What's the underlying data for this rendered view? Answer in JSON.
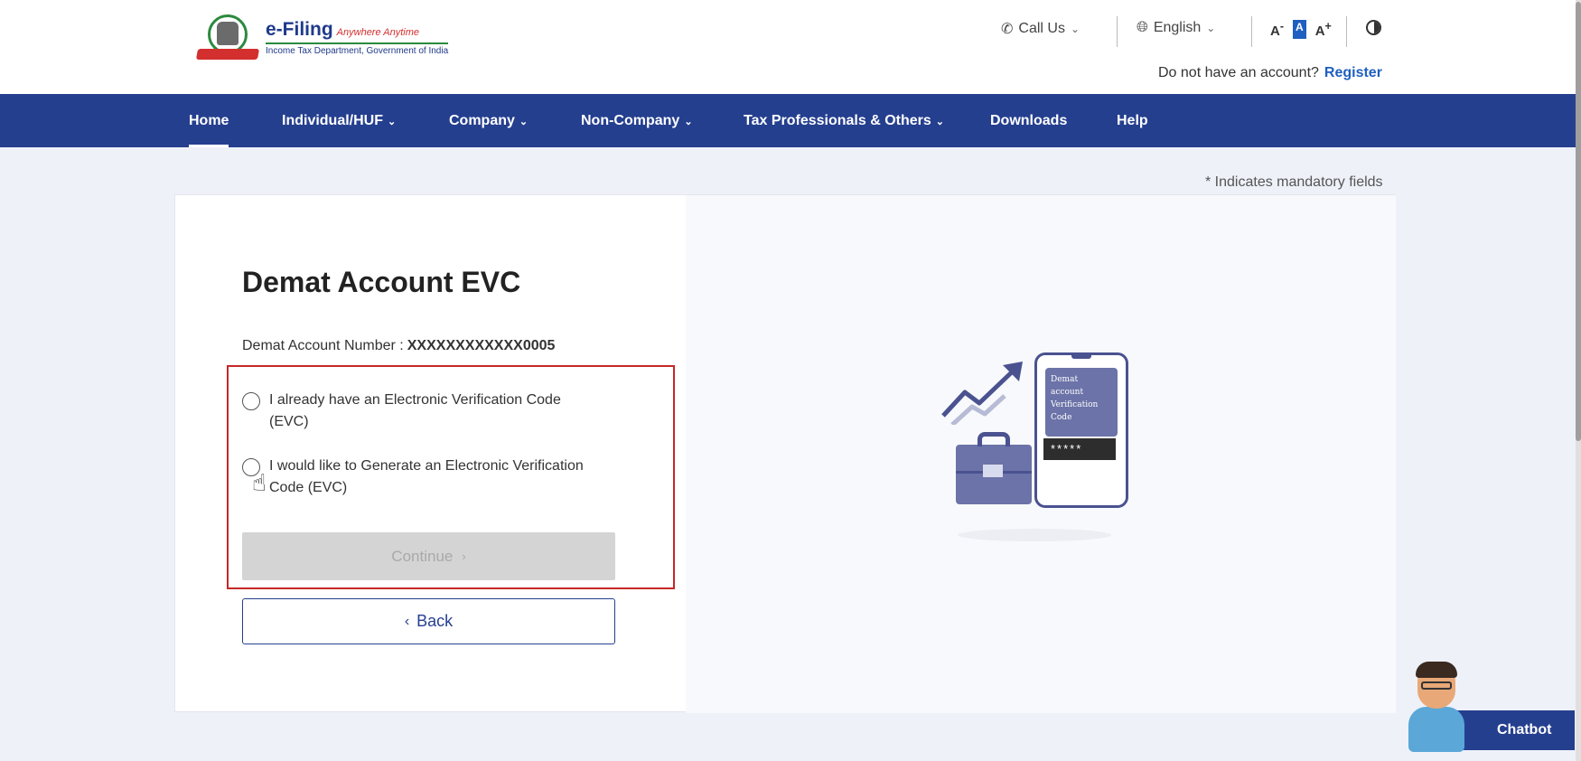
{
  "header": {
    "logo_title": "e-Filing",
    "logo_tagline": "Anywhere Anytime",
    "logo_subtitle": "Income Tax Department, Government of India",
    "call_us": "Call Us",
    "language": "English",
    "font_decrease": "A",
    "font_default": "A",
    "font_increase": "A",
    "account_prompt": "Do not have an account?",
    "register": "Register"
  },
  "nav": {
    "items": [
      {
        "label": "Home"
      },
      {
        "label": "Individual/HUF"
      },
      {
        "label": "Company"
      },
      {
        "label": "Non-Company"
      },
      {
        "label": "Tax Professionals & Others"
      },
      {
        "label": "Downloads"
      },
      {
        "label": "Help"
      }
    ]
  },
  "main": {
    "mandatory_note": "* Indicates mandatory fields",
    "title": "Demat Account EVC",
    "account_label": "Demat Account Number :",
    "account_value": "XXXXXXXXXXXX0005",
    "option_1": "I already have an Electronic Verification Code (EVC)",
    "option_2": "I would like to Generate an Electronic Verification Code (EVC)",
    "continue_label": "Continue",
    "back_label": "Back"
  },
  "illustration": {
    "screen_text": "Demat account Verification Code",
    "otp_mask": "*****"
  },
  "chatbot": {
    "label": "Chatbot"
  },
  "colors": {
    "nav_bg": "#253f8f",
    "accent": "#1f5fbf",
    "highlight_border": "#c62828",
    "disabled_button": "#d4d4d4"
  },
  "icons": [
    "phone-icon",
    "globe-icon",
    "chevron-down-icon",
    "contrast-icon",
    "chevron-right-icon",
    "chevron-left-icon",
    "hand-cursor-icon"
  ]
}
